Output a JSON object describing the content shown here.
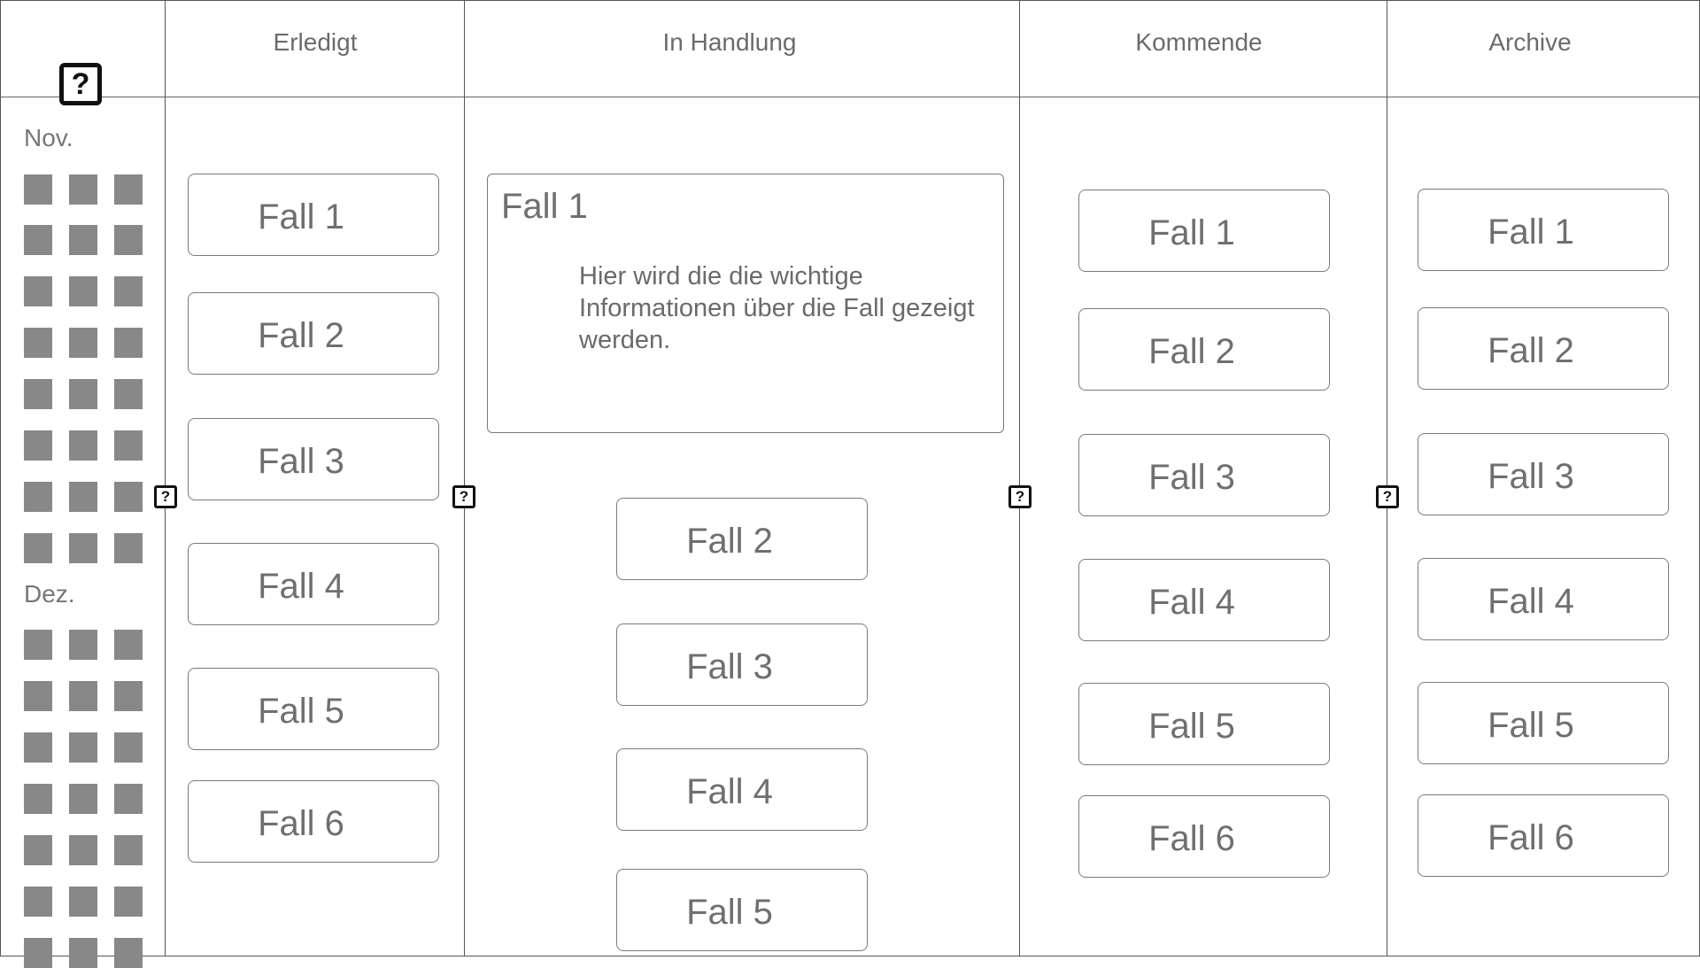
{
  "columns": {
    "done": "Erledigt",
    "in_progress": "In Handlung",
    "upcoming": "Kommende",
    "archive": "Archive"
  },
  "help_icon_glyph": "?",
  "calendar": {
    "months": [
      "Nov.",
      "Dez."
    ]
  },
  "done_cases": [
    "Fall 1",
    "Fall 2",
    "Fall 3",
    "Fall 4",
    "Fall 5",
    "Fall 6"
  ],
  "in_progress": {
    "expanded_case": {
      "title": "Fall 1",
      "description": "Hier wird die die wichtige Informationen über die Fall gezeigt werden."
    },
    "cases": [
      "Fall 2",
      "Fall 3",
      "Fall 4",
      "Fall 5"
    ]
  },
  "upcoming_cases": [
    "Fall 1",
    "Fall 2",
    "Fall 3",
    "Fall 4",
    "Fall 5",
    "Fall 6"
  ],
  "archive_cases": [
    "Fall 1",
    "Fall 2",
    "Fall 3",
    "Fall 4",
    "Fall 5",
    "Fall 6"
  ],
  "colors": {
    "border": "#555555",
    "card_border": "#7a7a7a",
    "text": "#6f6f6f",
    "square": "#888888",
    "icon": "#111111"
  }
}
